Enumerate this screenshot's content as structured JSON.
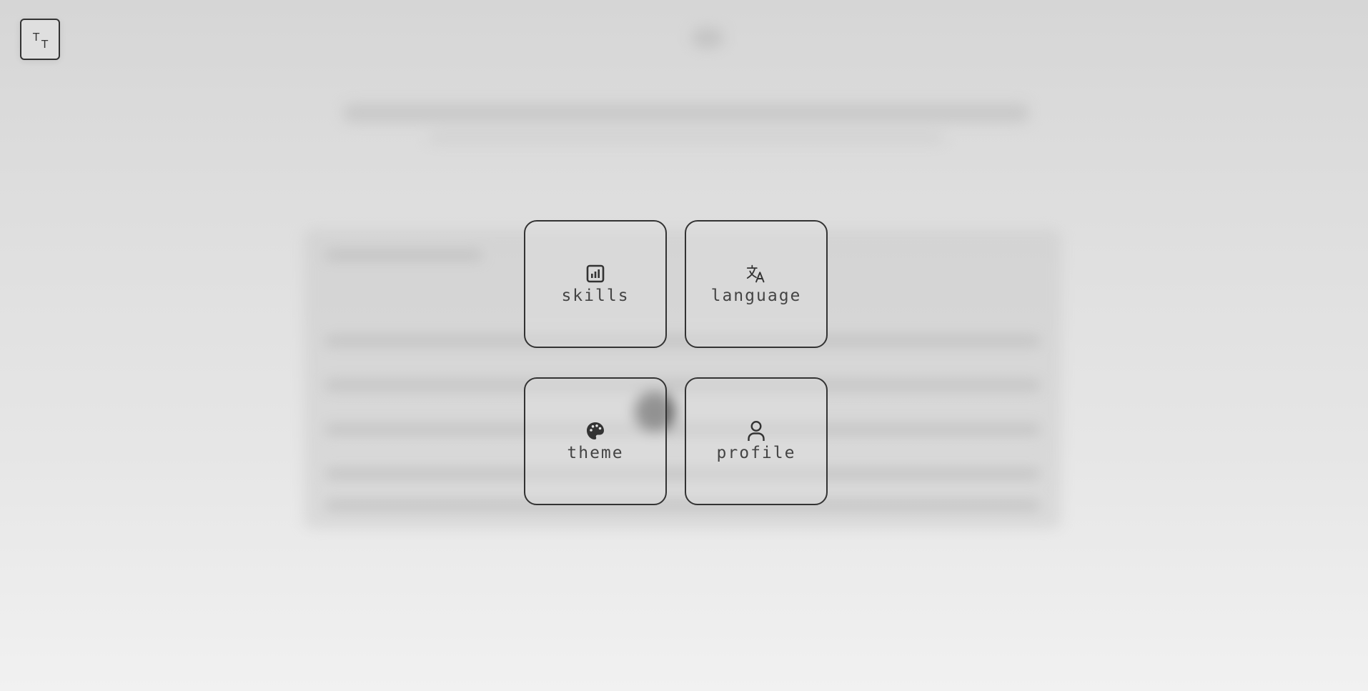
{
  "font_toggle": {
    "big_letter": "T",
    "small_letter": "T",
    "icon": "font-size-icon"
  },
  "menu": {
    "items": [
      {
        "label": "skills",
        "icon": "bar-chart-icon"
      },
      {
        "label": "language",
        "icon": "translate-icon"
      },
      {
        "label": "theme",
        "icon": "palette-icon"
      },
      {
        "label": "profile",
        "icon": "user-icon"
      }
    ]
  },
  "colors": {
    "border": "#333333",
    "text": "#444444"
  }
}
